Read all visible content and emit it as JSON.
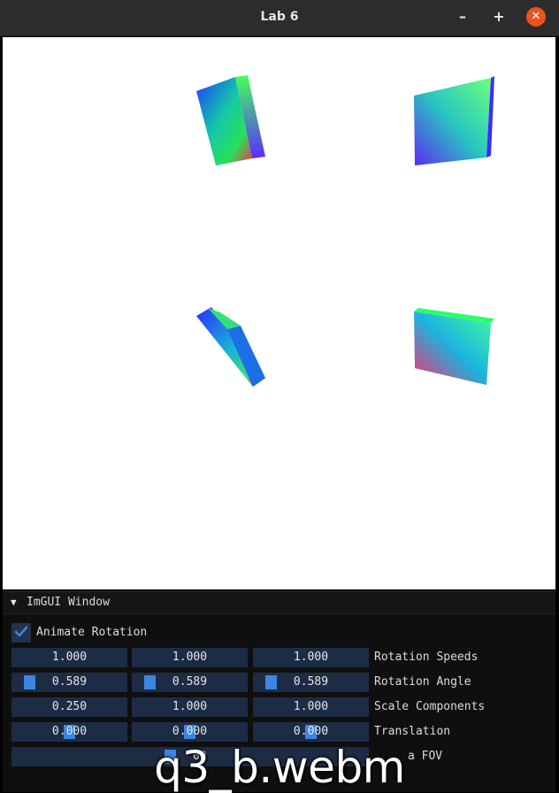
{
  "window": {
    "title": "Lab 6",
    "minimize_icon": "minimize-icon",
    "maximize_icon": "maximize-icon",
    "close_icon": "close-icon",
    "minimize_glyph": "–",
    "maximize_glyph": "+",
    "close_glyph": "✕",
    "close_color": "#e95420"
  },
  "imgui": {
    "title": "ImGUI Window",
    "collapse_icon": "triangle-down-icon",
    "collapse_glyph": "▼",
    "animate_rotation": {
      "label": "Animate Rotation",
      "checked": true
    },
    "rows": [
      {
        "label": "Rotation Speeds",
        "values": [
          "1.000",
          "1.000",
          "1.000"
        ]
      },
      {
        "label": "Rotation Angle",
        "values": [
          "0.589",
          "0.589",
          "0.589"
        ]
      },
      {
        "label": "Scale Components",
        "values": [
          "0.250",
          "1.000",
          "1.000"
        ]
      },
      {
        "label": "Translation",
        "values": [
          "0.000",
          "0.000",
          "0.000"
        ]
      }
    ],
    "camera_row": {
      "label_visible": "a FOV",
      "value_visible": "00"
    },
    "accent_color": "#3d85e0",
    "field_color": "#1d2c45"
  },
  "caption": "q3_b.webm"
}
